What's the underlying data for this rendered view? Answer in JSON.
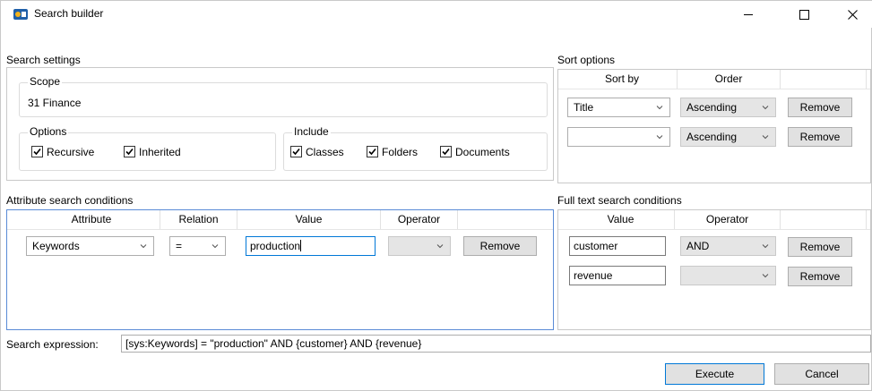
{
  "window": {
    "title": "Search builder"
  },
  "search_settings": {
    "label": "Search settings",
    "scope_legend": "Scope",
    "scope_value": "31 Finance",
    "options_legend": "Options",
    "options": [
      {
        "label": "Recursive",
        "checked": true
      },
      {
        "label": "Inherited",
        "checked": true
      }
    ],
    "include_legend": "Include",
    "include": [
      {
        "label": "Classes",
        "checked": true
      },
      {
        "label": "Folders",
        "checked": true
      },
      {
        "label": "Documents",
        "checked": true
      }
    ]
  },
  "sort_options": {
    "label": "Sort options",
    "headers": [
      "Sort by",
      "Order"
    ],
    "rows": [
      {
        "sort_by": "Title",
        "order": "Ascending",
        "remove": "Remove"
      },
      {
        "sort_by": "",
        "order": "Ascending",
        "remove": "Remove"
      }
    ]
  },
  "attribute_conditions": {
    "label": "Attribute search conditions",
    "headers": [
      "Attribute",
      "Relation",
      "Value",
      "Operator"
    ],
    "rows": [
      {
        "attribute": "Keywords",
        "relation": "=",
        "value": "production",
        "operator": "",
        "remove": "Remove"
      }
    ]
  },
  "fulltext_conditions": {
    "label": "Full text search conditions",
    "headers": [
      "Value",
      "Operator"
    ],
    "rows": [
      {
        "value": "customer",
        "operator": "AND",
        "remove": "Remove"
      },
      {
        "value": "revenue",
        "operator": "",
        "remove": "Remove"
      }
    ]
  },
  "search_expression": {
    "label": "Search expression:",
    "value": "[sys:Keywords] = \"production\" AND {customer} AND {revenue}"
  },
  "buttons": {
    "execute": "Execute",
    "cancel": "Cancel"
  },
  "colors": {
    "accent": "#0078d7",
    "panel_border_blue": "#5a8bd6",
    "button_bg": "#e1e1e1"
  },
  "icons": {
    "app": "ibis-app-icon",
    "minimize": "minimize-icon",
    "maximize": "maximize-icon",
    "close": "close-icon",
    "checkbox": "checkmark-icon",
    "dropdown": "chevron-down-icon"
  }
}
